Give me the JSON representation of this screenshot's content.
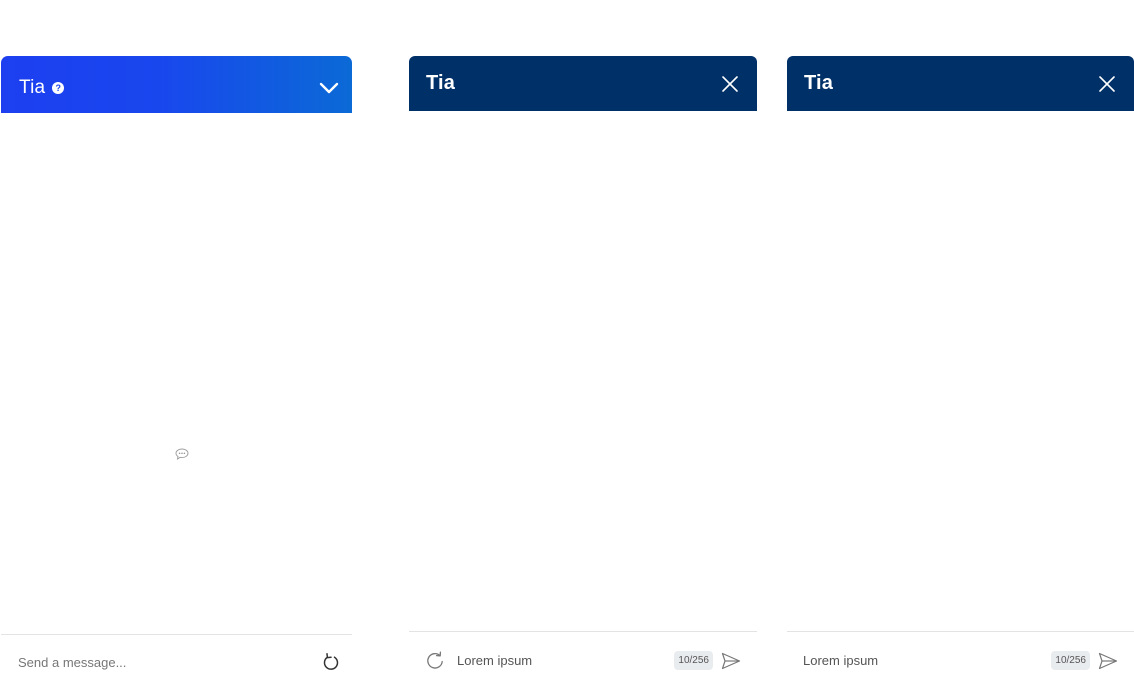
{
  "panel_1": {
    "title": "Tia",
    "help_icon": "?",
    "input_placeholder": "Send a message..."
  },
  "panel_2": {
    "title": "Tia",
    "input_value": "Lorem ipsum",
    "char_counter": "10/256"
  },
  "panel_3": {
    "title": "Tia",
    "input_value": "Lorem ipsum",
    "char_counter": "10/256"
  },
  "colors": {
    "panel_1_header_start": "#1d3ff0",
    "panel_1_header_end": "#0b6ad6",
    "dark_header": "#003068",
    "divider": "#e3e3e3",
    "counter_bg": "#e9ecef"
  },
  "icons": {
    "panel_1": [
      "help-icon",
      "chevron-down-icon",
      "typing-bubble-icon",
      "refresh-icon"
    ],
    "panel_2": [
      "close-icon",
      "refresh-icon",
      "send-icon"
    ],
    "panel_3": [
      "close-icon",
      "send-icon"
    ]
  }
}
